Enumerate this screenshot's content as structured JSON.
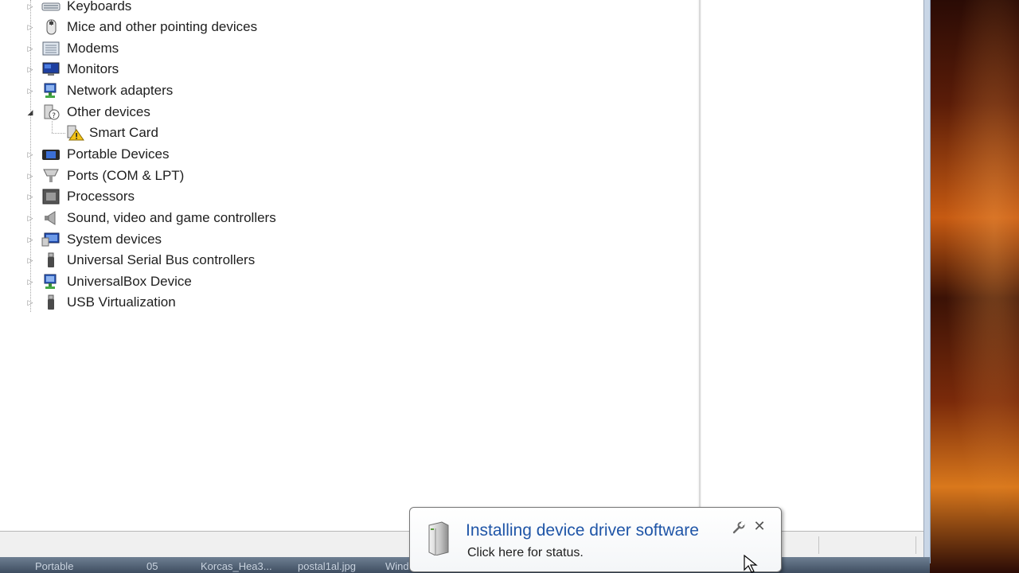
{
  "tree": {
    "items": [
      {
        "label": "Keyboards",
        "icon": "keyboard-icon",
        "expanded": false
      },
      {
        "label": "Mice and other pointing devices",
        "icon": "mouse-icon",
        "expanded": false
      },
      {
        "label": "Modems",
        "icon": "modem-icon",
        "expanded": false
      },
      {
        "label": "Monitors",
        "icon": "monitor-icon",
        "expanded": false
      },
      {
        "label": "Network adapters",
        "icon": "network-adapter-icon",
        "expanded": false
      },
      {
        "label": "Other devices",
        "icon": "other-devices-icon",
        "expanded": true,
        "children": [
          {
            "label": "Smart Card",
            "icon": "unknown-device-warning-icon"
          }
        ]
      },
      {
        "label": "Portable Devices",
        "icon": "portable-device-icon",
        "expanded": false
      },
      {
        "label": "Ports (COM & LPT)",
        "icon": "port-icon",
        "expanded": false
      },
      {
        "label": "Processors",
        "icon": "processor-icon",
        "expanded": false
      },
      {
        "label": "Sound, video and game controllers",
        "icon": "speaker-icon",
        "expanded": false
      },
      {
        "label": "System devices",
        "icon": "system-devices-icon",
        "expanded": false
      },
      {
        "label": "Universal Serial Bus controllers",
        "icon": "usb-icon",
        "expanded": false
      },
      {
        "label": "UniversalBox Device",
        "icon": "network-adapter-icon",
        "expanded": false
      },
      {
        "label": "USB Virtualization",
        "icon": "usb-icon",
        "expanded": false
      }
    ]
  },
  "notification": {
    "title": "Installing device driver software",
    "text": "Click here for status.",
    "icon": "device-driver-icon"
  },
  "taskbar": {
    "items": [
      "Portable",
      "05",
      "Korcas_Hea3...",
      "postal1al.jpg",
      "Wind"
    ]
  },
  "colors": {
    "balloon_title": "#1f55a7",
    "window_frame": "#c9d6e6"
  }
}
